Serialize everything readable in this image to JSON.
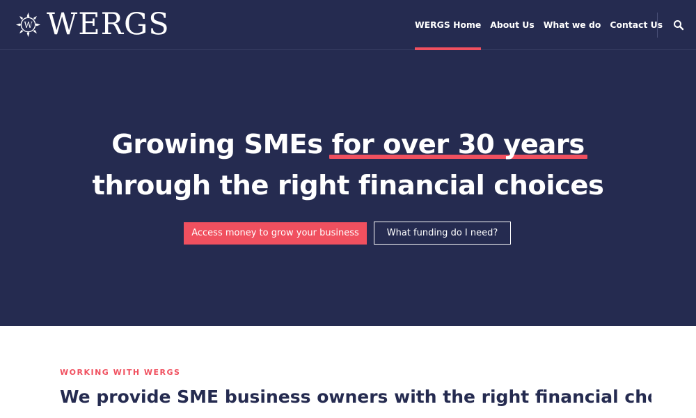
{
  "brand": {
    "name": "WERGS",
    "mark_letter": "W"
  },
  "nav": {
    "items": [
      {
        "label": "WERGS Home",
        "active": true
      },
      {
        "label": "About Us",
        "active": false
      },
      {
        "label": "What we do",
        "active": false
      },
      {
        "label": "Contact Us",
        "active": false
      }
    ],
    "search_icon": "search-icon"
  },
  "hero": {
    "headline_part1": "Growing SMEs ",
    "headline_highlight": "for over 30 years",
    "headline_line2": "through the right financial choices",
    "primary_button": "Access money to grow your business",
    "secondary_button": "What funding do I need?"
  },
  "section": {
    "eyebrow": "WORKING WITH WERGS",
    "intro": "We provide SME business owners with the right financial choices,"
  },
  "colors": {
    "navy": "#252b50",
    "accent": "#f0505f",
    "white": "#ffffff"
  }
}
